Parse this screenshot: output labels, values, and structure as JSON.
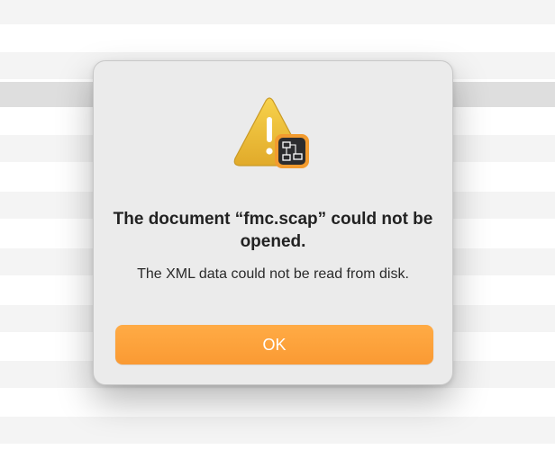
{
  "dialog": {
    "title": "The document “fmc.scap” could not be opened.",
    "message": "The XML data could not be read from disk.",
    "ok_label": "OK"
  },
  "icons": {
    "alert": "warning-icon",
    "badge": "app-document-badge-icon"
  },
  "colors": {
    "accent_button": "#fba23c",
    "warning_yellow": "#f2c33a",
    "dialog_background": "#ebebeb"
  }
}
